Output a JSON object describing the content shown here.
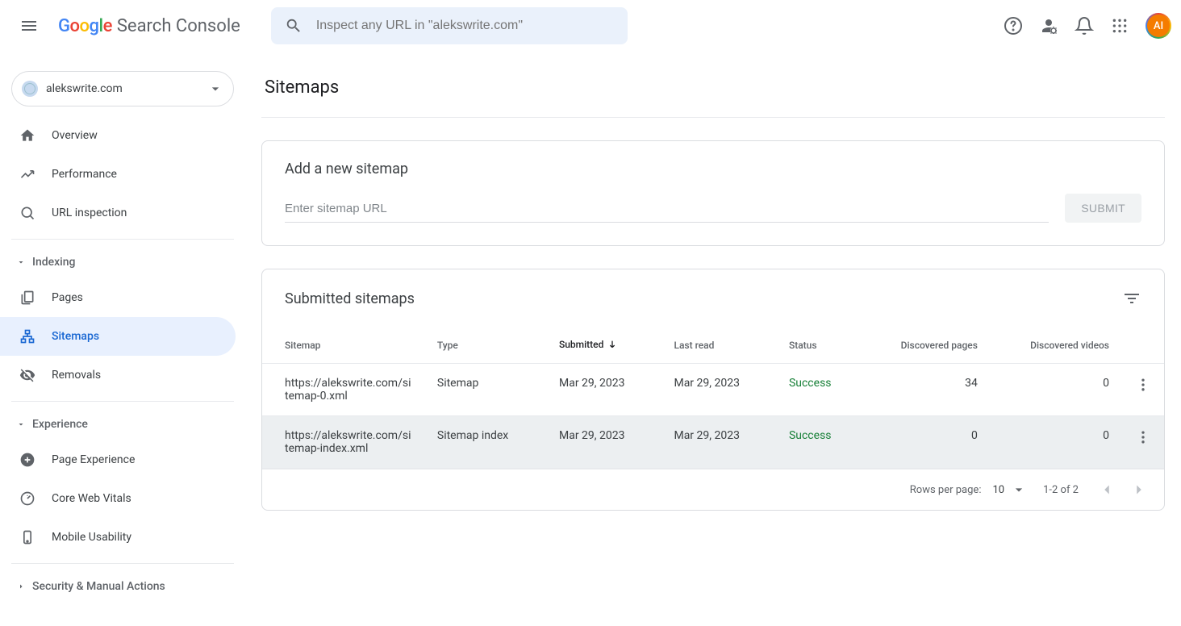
{
  "header": {
    "logo_text": "Search Console",
    "search_placeholder": "Inspect any URL in \"alekswrite.com\"",
    "avatar_initials": "AI"
  },
  "sidebar": {
    "property": "alekswrite.com",
    "items": {
      "overview": "Overview",
      "performance": "Performance",
      "url_inspection": "URL inspection",
      "pages": "Pages",
      "sitemaps": "Sitemaps",
      "removals": "Removals",
      "page_experience": "Page Experience",
      "core_web_vitals": "Core Web Vitals",
      "mobile_usability": "Mobile Usability"
    },
    "sections": {
      "indexing": "Indexing",
      "experience": "Experience",
      "security": "Security & Manual Actions"
    }
  },
  "main": {
    "page_title": "Sitemaps",
    "add_card": {
      "title": "Add a new sitemap",
      "placeholder": "Enter sitemap URL",
      "submit_label": "SUBMIT"
    },
    "table_card": {
      "title": "Submitted sitemaps",
      "columns": {
        "sitemap": "Sitemap",
        "type": "Type",
        "submitted": "Submitted",
        "last_read": "Last read",
        "status": "Status",
        "disc_pages": "Discovered pages",
        "disc_videos": "Discovered videos"
      },
      "rows": [
        {
          "sitemap": "https://alekswrite.com/sitemap-0.xml",
          "type": "Sitemap",
          "submitted": "Mar 29, 2023",
          "last_read": "Mar 29, 2023",
          "status": "Success",
          "pages": "34",
          "videos": "0"
        },
        {
          "sitemap": "https://alekswrite.com/sitemap-index.xml",
          "type": "Sitemap index",
          "submitted": "Mar 29, 2023",
          "last_read": "Mar 29, 2023",
          "status": "Success",
          "pages": "0",
          "videos": "0"
        }
      ],
      "footer": {
        "rpp_label": "Rows per page:",
        "rpp_value": "10",
        "range": "1-2 of 2"
      }
    }
  }
}
